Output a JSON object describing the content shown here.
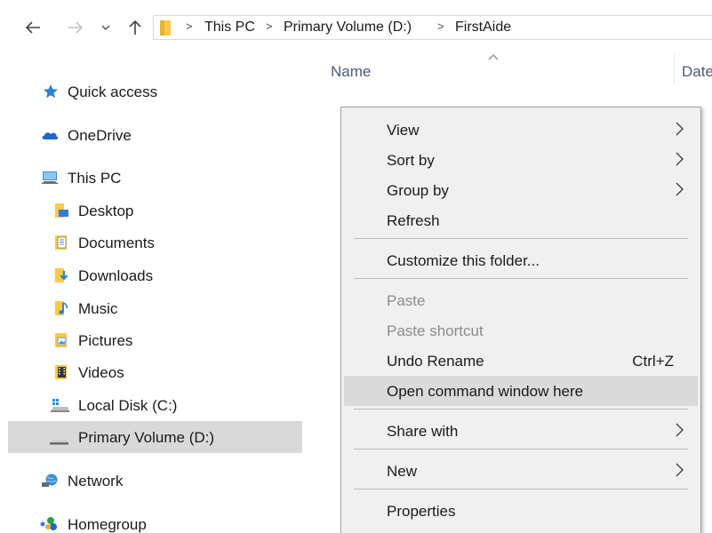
{
  "breadcrumb": {
    "items": [
      "This PC",
      "Primary Volume (D:)",
      "FirstAide"
    ]
  },
  "columns": {
    "name": "Name",
    "date": "Date"
  },
  "sidebar": {
    "items": [
      {
        "label": "Quick access",
        "icon": "star-icon"
      },
      {
        "label": "OneDrive",
        "icon": "cloud-icon"
      },
      {
        "label": "This PC",
        "icon": "computer-icon"
      },
      {
        "label": "Desktop",
        "icon": "desktop-folder-icon"
      },
      {
        "label": "Documents",
        "icon": "documents-folder-icon"
      },
      {
        "label": "Downloads",
        "icon": "downloads-folder-icon"
      },
      {
        "label": "Music",
        "icon": "music-folder-icon"
      },
      {
        "label": "Pictures",
        "icon": "pictures-folder-icon"
      },
      {
        "label": "Videos",
        "icon": "videos-folder-icon"
      },
      {
        "label": "Local Disk (C:)",
        "icon": "windows-drive-icon"
      },
      {
        "label": "Primary Volume (D:)",
        "icon": "drive-icon",
        "selected": true
      },
      {
        "label": "Network",
        "icon": "network-icon"
      },
      {
        "label": "Homegroup",
        "icon": "homegroup-icon"
      }
    ]
  },
  "context_menu": {
    "items": [
      {
        "label": "View",
        "submenu": true
      },
      {
        "label": "Sort by",
        "submenu": true
      },
      {
        "label": "Group by",
        "submenu": true
      },
      {
        "label": "Refresh"
      },
      {
        "label": "Customize this folder..."
      },
      {
        "label": "Paste",
        "disabled": true
      },
      {
        "label": "Paste shortcut",
        "disabled": true
      },
      {
        "label": "Undo Rename",
        "shortcut": "Ctrl+Z"
      },
      {
        "label": "Open command window here",
        "highlighted": true
      },
      {
        "label": "Share with",
        "submenu": true
      },
      {
        "label": "New",
        "submenu": true
      },
      {
        "label": "Properties"
      }
    ]
  },
  "colors": {
    "folder_yellow": "#f8c94a",
    "accent_blue": "#2f7fd1",
    "selection_gray": "#d9d9d9",
    "menu_bg": "#f0f0f0"
  }
}
